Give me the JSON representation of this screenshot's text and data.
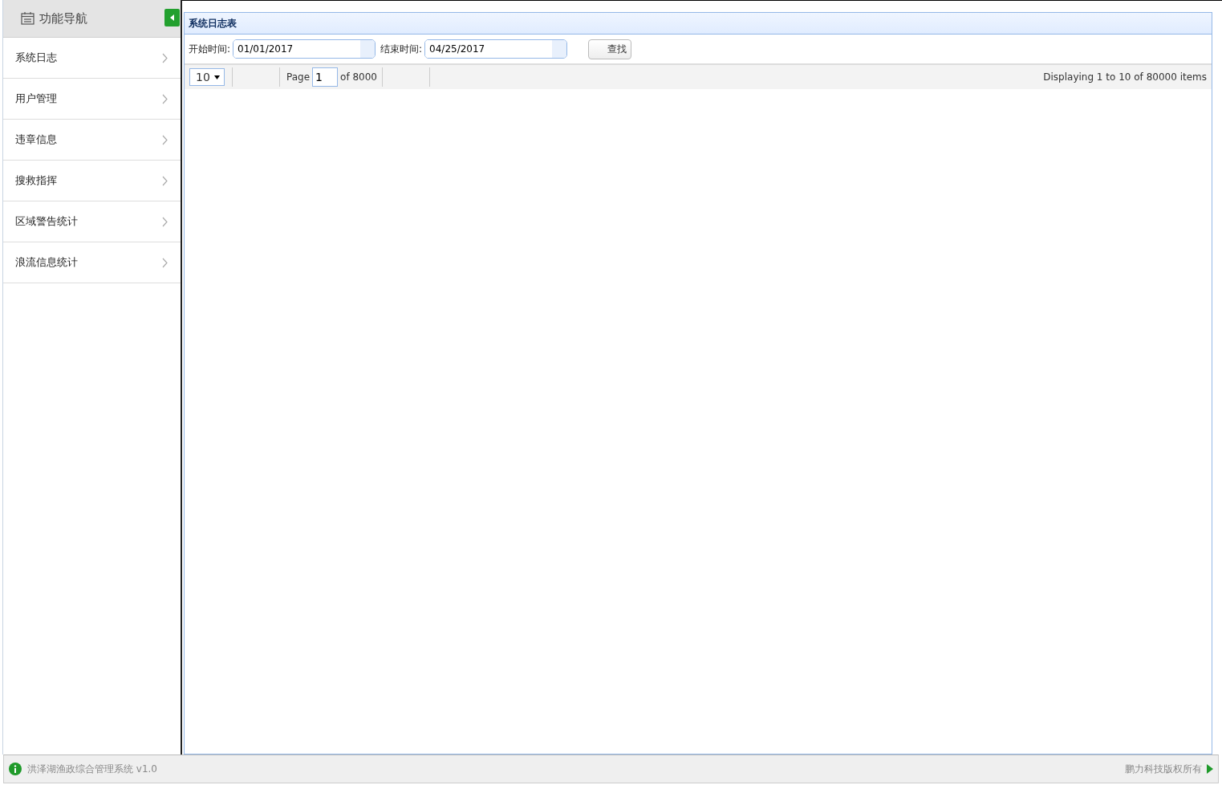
{
  "sidebar": {
    "title": "功能导航",
    "items": [
      {
        "label": "系统日志"
      },
      {
        "label": "用户管理"
      },
      {
        "label": "违章信息"
      },
      {
        "label": "搜救指挥"
      },
      {
        "label": "区域警告统计"
      },
      {
        "label": "浪流信息统计"
      }
    ]
  },
  "panel": {
    "title": "系统日志表",
    "filters": [
      {
        "label": "开始时间:",
        "value": "01/01/2017"
      },
      {
        "label": "结束时间:",
        "value": "04/25/2017"
      }
    ],
    "search_button": "查找",
    "pager": {
      "page_size": "10",
      "page_label": "Page",
      "page": "1",
      "of_pages": "of 8000",
      "display": "Displaying 1 to 10 of 80000 items"
    }
  },
  "footer": {
    "app_name": "洪泽湖渔政综合管理系统 v1.0",
    "copyright": "鹏力科技版权所有"
  }
}
